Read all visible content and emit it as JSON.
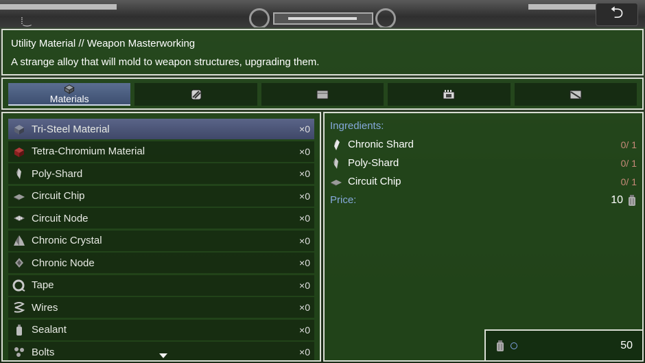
{
  "header": {
    "back_icon": "return-arrow-icon"
  },
  "description": {
    "title": "Utility Material // Weapon Masterworking",
    "text": "A strange alloy that will mold to weapon structures, upgrading them."
  },
  "tabs": [
    {
      "label": "Materials",
      "icon": "materials-icon",
      "active": true
    },
    {
      "label": "",
      "icon": "fuel-tank-icon",
      "active": false
    },
    {
      "label": "",
      "icon": "box-icon",
      "active": false
    },
    {
      "label": "",
      "icon": "circuit-icon",
      "active": false
    },
    {
      "label": "",
      "icon": "plate-icon",
      "active": false
    }
  ],
  "materials": [
    {
      "name": "Tri-Steel Material",
      "count": "×0",
      "icon": "tri-steel-icon",
      "selected": true
    },
    {
      "name": "Tetra-Chromium Material",
      "count": "×0",
      "icon": "tetra-chromium-icon",
      "selected": false
    },
    {
      "name": "Poly-Shard",
      "count": "×0",
      "icon": "poly-shard-icon",
      "selected": false
    },
    {
      "name": "Circuit Chip",
      "count": "×0",
      "icon": "circuit-chip-icon",
      "selected": false
    },
    {
      "name": "Circuit Node",
      "count": "×0",
      "icon": "circuit-node-icon",
      "selected": false
    },
    {
      "name": "Chronic Crystal",
      "count": "×0",
      "icon": "chronic-crystal-icon",
      "selected": false
    },
    {
      "name": "Chronic Node",
      "count": "×0",
      "icon": "chronic-node-icon",
      "selected": false
    },
    {
      "name": "Tape",
      "count": "×0",
      "icon": "tape-icon",
      "selected": false
    },
    {
      "name": "Wires",
      "count": "×0",
      "icon": "wires-icon",
      "selected": false
    },
    {
      "name": "Sealant",
      "count": "×0",
      "icon": "sealant-icon",
      "selected": false
    },
    {
      "name": "Bolts",
      "count": "×0",
      "icon": "bolts-icon",
      "selected": false
    }
  ],
  "detail": {
    "ingredients_label": "Ingredients:",
    "ingredients": [
      {
        "name": "Chronic Shard",
        "qty": "0/ 1",
        "icon": "chronic-shard-icon"
      },
      {
        "name": "Poly-Shard",
        "qty": "0/ 1",
        "icon": "poly-shard-icon"
      },
      {
        "name": "Circuit Chip",
        "qty": "0/ 1",
        "icon": "circuit-chip-icon"
      }
    ],
    "price_label": "Price:",
    "price_value": "10",
    "price_icon": "currency-canister-icon"
  },
  "wallet": {
    "value": "50",
    "icon": "currency-canister-icon"
  }
}
